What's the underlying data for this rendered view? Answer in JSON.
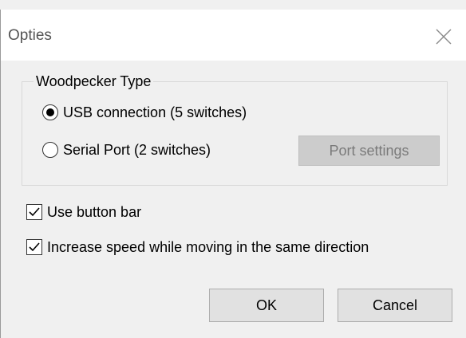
{
  "dialog": {
    "title": "Opties",
    "close_icon": "close-icon"
  },
  "woodpecker_group": {
    "legend": "Woodpecker Type",
    "options": [
      {
        "label": "USB connection (5 switches)",
        "selected": true
      },
      {
        "label": "Serial Port (2 switches)",
        "selected": false
      }
    ],
    "port_settings_label": "Port settings",
    "port_settings_enabled": false
  },
  "options": {
    "use_button_bar": {
      "label": "Use button bar",
      "checked": true
    },
    "increase_speed": {
      "label": "Increase speed while moving in the same direction",
      "checked": true
    }
  },
  "buttons": {
    "ok_label": "OK",
    "cancel_label": "Cancel"
  }
}
